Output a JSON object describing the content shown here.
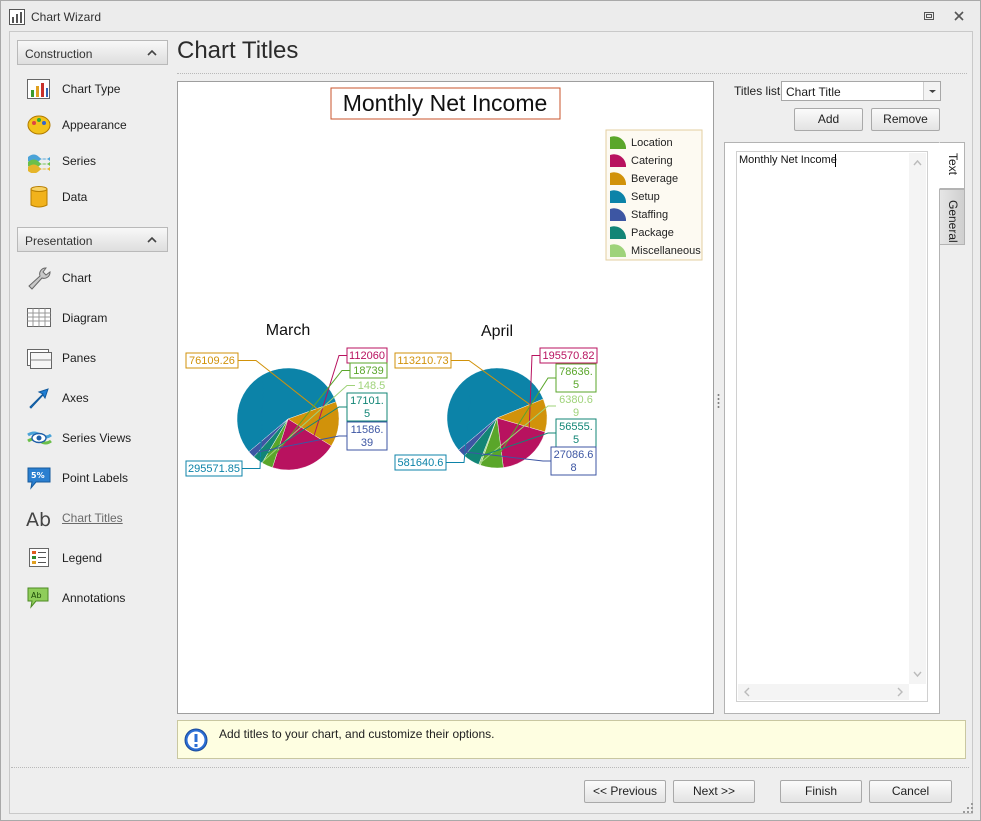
{
  "window": {
    "title": "Chart Wizard"
  },
  "sidebar": {
    "construction_header": "Construction",
    "presentation_header": "Presentation",
    "construction_items": [
      {
        "label": "Chart Type",
        "icon": "chart-type-icon"
      },
      {
        "label": "Appearance",
        "icon": "appearance-icon"
      },
      {
        "label": "Series",
        "icon": "series-icon"
      },
      {
        "label": "Data",
        "icon": "data-icon"
      }
    ],
    "presentation_items": [
      {
        "label": "Chart",
        "icon": "wrench-icon"
      },
      {
        "label": "Diagram",
        "icon": "diagram-grid-icon"
      },
      {
        "label": "Panes",
        "icon": "panes-icon"
      },
      {
        "label": "Axes",
        "icon": "axes-arrow-icon"
      },
      {
        "label": "Series Views",
        "icon": "series-views-eye-icon"
      },
      {
        "label": "Point Labels",
        "icon": "point-labels-icon"
      },
      {
        "label": "Chart Titles",
        "icon": "chart-titles-ab-icon"
      },
      {
        "label": "Legend",
        "icon": "legend-icon"
      },
      {
        "label": "Annotations",
        "icon": "annotations-icon"
      }
    ]
  },
  "page": {
    "title": "Chart Titles"
  },
  "chart_data": {
    "type": "pie",
    "title": "Monthly Net Income",
    "legend": {
      "placement": "top-right",
      "items": [
        {
          "name": "Location",
          "color": "#5aa62a"
        },
        {
          "name": "Catering",
          "color": "#b8125f"
        },
        {
          "name": "Beverage",
          "color": "#d1920a"
        },
        {
          "name": "Setup",
          "color": "#0c83a8"
        },
        {
          "name": "Staffing",
          "color": "#3d56a3"
        },
        {
          "name": "Package",
          "color": "#128576"
        },
        {
          "name": "Miscellaneous",
          "color": "#9fd37a"
        }
      ]
    },
    "series": [
      {
        "name": "March",
        "slices": [
          {
            "category": "Setup",
            "value": 295571.85,
            "label": "295571.85"
          },
          {
            "category": "Beverage",
            "value": 76109.26,
            "label": "76109.26"
          },
          {
            "category": "Catering",
            "value": 112060,
            "label": "112060"
          },
          {
            "category": "Location",
            "value": 18739,
            "label": "18739"
          },
          {
            "category": "Miscellaneous",
            "value": 148.5,
            "label": "148.5"
          },
          {
            "category": "Package",
            "value": 17101.5,
            "label": "17101.\n5"
          },
          {
            "category": "Staffing",
            "value": 11586.39,
            "label": "11586.\n39"
          }
        ]
      },
      {
        "name": "April",
        "slices": [
          {
            "category": "Setup",
            "value": 581640.6,
            "label": "581640.6"
          },
          {
            "category": "Beverage",
            "value": 113210.73,
            "label": "113210.73"
          },
          {
            "category": "Catering",
            "value": 195570.82,
            "label": "195570.82"
          },
          {
            "category": "Location",
            "value": 78636.5,
            "label": "78636.\n5"
          },
          {
            "category": "Miscellaneous",
            "value": 6380.69,
            "label": "6380.6\n9"
          },
          {
            "category": "Package",
            "value": 56555.5,
            "label": "56555.\n5"
          },
          {
            "category": "Staffing",
            "value": 27086.68,
            "label": "27086.6\n8"
          }
        ]
      }
    ]
  },
  "titles_panel": {
    "label": "Titles list:",
    "selected": "Chart Title",
    "add_label": "Add",
    "remove_label": "Remove",
    "text_value": "Monthly Net Income",
    "tabs": [
      "Text",
      "General"
    ]
  },
  "hint": {
    "text": "Add titles to your chart, and customize their options."
  },
  "footer": {
    "previous_label": "<< Previous",
    "next_label": "Next >>",
    "finish_label": "Finish",
    "cancel_label": "Cancel"
  }
}
